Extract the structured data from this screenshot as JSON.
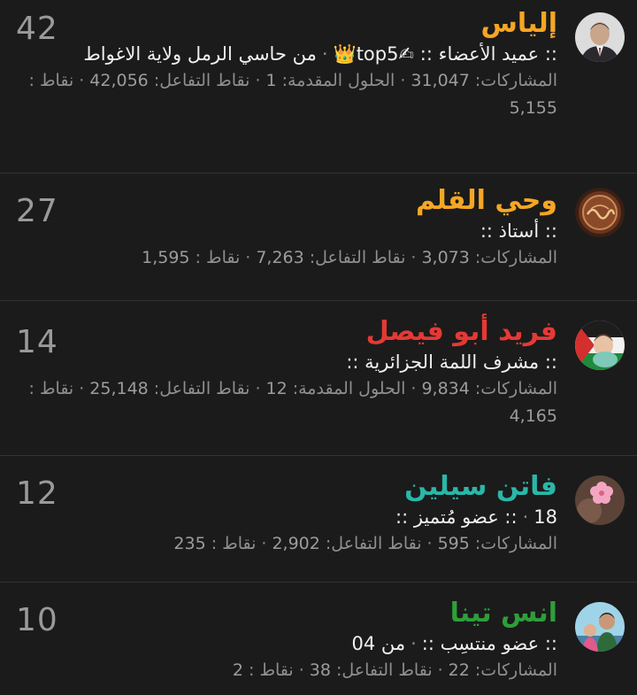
{
  "members": [
    {
      "score": "42",
      "name": "إلياس",
      "name_color": "#f5a623",
      "title_prefix": "::",
      "title_rank": "عميد الأعضاء",
      "title_mid": "::",
      "badge_writing": "✍",
      "badge_top": "top5",
      "badge_crown": "👑",
      "location": "من حاسي الرمل ولاية الاغواط",
      "posts_label": "المشاركات:",
      "posts_value": "31,047",
      "solutions_label": "الحلول المقدمة:",
      "solutions_value": "1",
      "reactions_label": "نقاط التفاعل:",
      "reactions_value": "42,056",
      "points_label": "نقاط :",
      "points_value": "5,155",
      "avatar_icon": "man-portrait"
    },
    {
      "score": "27",
      "name": "وحي القلم",
      "name_color": "#f5a623",
      "title_text": ":: أستاذ ::",
      "posts_label": "المشاركات:",
      "posts_value": "3,073",
      "reactions_label": "نقاط التفاعل:",
      "reactions_value": "7,263",
      "points_label": "نقاط :",
      "points_value": "1,595",
      "avatar_icon": "calligraphy-emblem"
    },
    {
      "score": "14",
      "name": "فريد أبو فيصل",
      "name_color": "#e53935",
      "title_text": ":: مشرف اللمة الجزائرية ::",
      "posts_label": "المشاركات:",
      "posts_value": "9,834",
      "solutions_label": "الحلول المقدمة:",
      "solutions_value": "12",
      "reactions_label": "نقاط التفاعل:",
      "reactions_value": "25,148",
      "points_label": "نقاط :",
      "points_value": "4,165",
      "avatar_icon": "child-with-flag"
    },
    {
      "score": "12",
      "name": "فاتن سيلين",
      "name_color": "#2ab7a9",
      "title_text": ":: عضو مُتميز ::",
      "age": "18",
      "posts_label": "المشاركات:",
      "posts_value": "595",
      "reactions_label": "نقاط التفاعل:",
      "reactions_value": "2,902",
      "points_label": "نقاط :",
      "points_value": "235",
      "avatar_icon": "pink-flower"
    },
    {
      "score": "10",
      "name": "انس تينا",
      "name_color": "#2e9e3a",
      "title_text": ":: عضو منتسِب ::",
      "from_text": "من 04",
      "posts_label": "المشاركات:",
      "posts_value": "22",
      "reactions_label": "نقاط التفاعل:",
      "reactions_value": "38",
      "points_label": "نقاط :",
      "points_value": "2",
      "avatar_icon": "family-photo"
    }
  ]
}
